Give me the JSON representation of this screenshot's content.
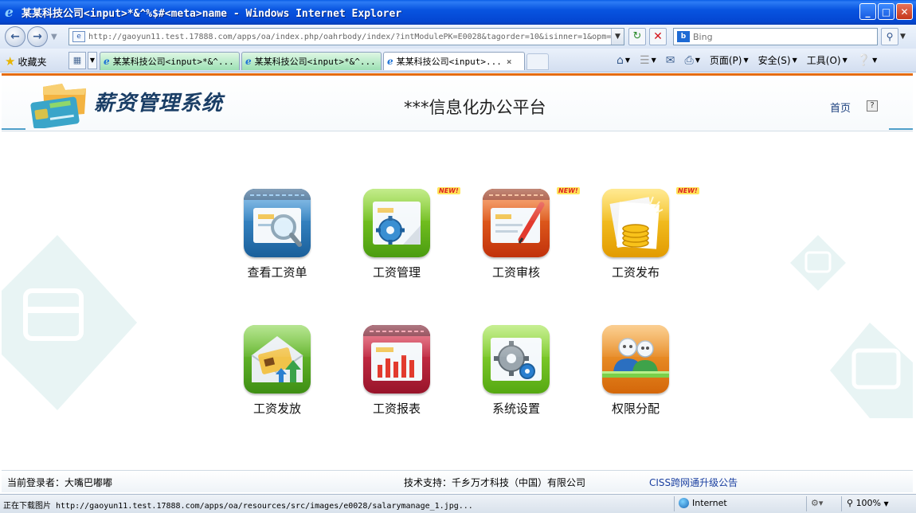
{
  "window": {
    "title": "某某科技公司<input>*&^%$#<meta>name - Windows Internet Explorer",
    "minimize": "_",
    "maximize": "□",
    "close": "✕"
  },
  "address_bar": {
    "url": "http://gaoyun11.test.17888.com/apps/oa/index.php/oahrbody/index/?intModulePK=E0028&tagorder=10&isinner=1&opm=1",
    "search_placeholder": "Bing"
  },
  "toolbar": {
    "favorites": "收藏夹",
    "tabs": [
      {
        "label": "某某科技公司<input>*&^...",
        "active": false
      },
      {
        "label": "某某科技公司<input>*&^...",
        "active": false
      },
      {
        "label": "某某科技公司<input>...",
        "active": true
      }
    ],
    "page_menu": "页面(P)",
    "safety_menu": "安全(S)",
    "tools_menu": "工具(O)"
  },
  "page": {
    "system_title": "薪资管理系统",
    "platform_title": "***信息化办公平台",
    "home_link": "首页",
    "help": "?",
    "new_badge": "NEW!",
    "apps": [
      {
        "label": "查看工资单",
        "icon": "salary-slip-search-icon",
        "color": "#2f7fbf",
        "new": false
      },
      {
        "label": "工资管理",
        "icon": "salary-management-gear-icon",
        "color": "#6cc120",
        "new": true
      },
      {
        "label": "工资审核",
        "icon": "salary-audit-pen-icon",
        "color": "#e04a12",
        "new": true
      },
      {
        "label": "工资发布",
        "icon": "salary-publish-coins-icon",
        "color": "#f2b80a",
        "new": true
      },
      {
        "label": "工资发放",
        "icon": "salary-pay-envelope-icon",
        "color": "#5db324",
        "new": false
      },
      {
        "label": "工资报表",
        "icon": "salary-report-chart-icon",
        "color": "#c0213a",
        "new": false
      },
      {
        "label": "系统设置",
        "icon": "system-settings-gear-icon",
        "color": "#7ac51e",
        "new": false
      },
      {
        "label": "权限分配",
        "icon": "permission-users-icon",
        "color": "#ee8a1a",
        "new": false
      }
    ]
  },
  "footer": {
    "current_user": "当前登录者：大嘴巴嘟嘟",
    "tech_support": "技术支持：千乡万才科技（中国）有限公司",
    "notice": "CISS跨网通升级公告"
  },
  "statusbar": {
    "status_text": "正在下载图片 http://gaoyun11.test.17888.com/apps/oa/resources/src/images/e0028/salarymanage_1.jpg...",
    "zone": "Internet",
    "zoom": "100%"
  }
}
